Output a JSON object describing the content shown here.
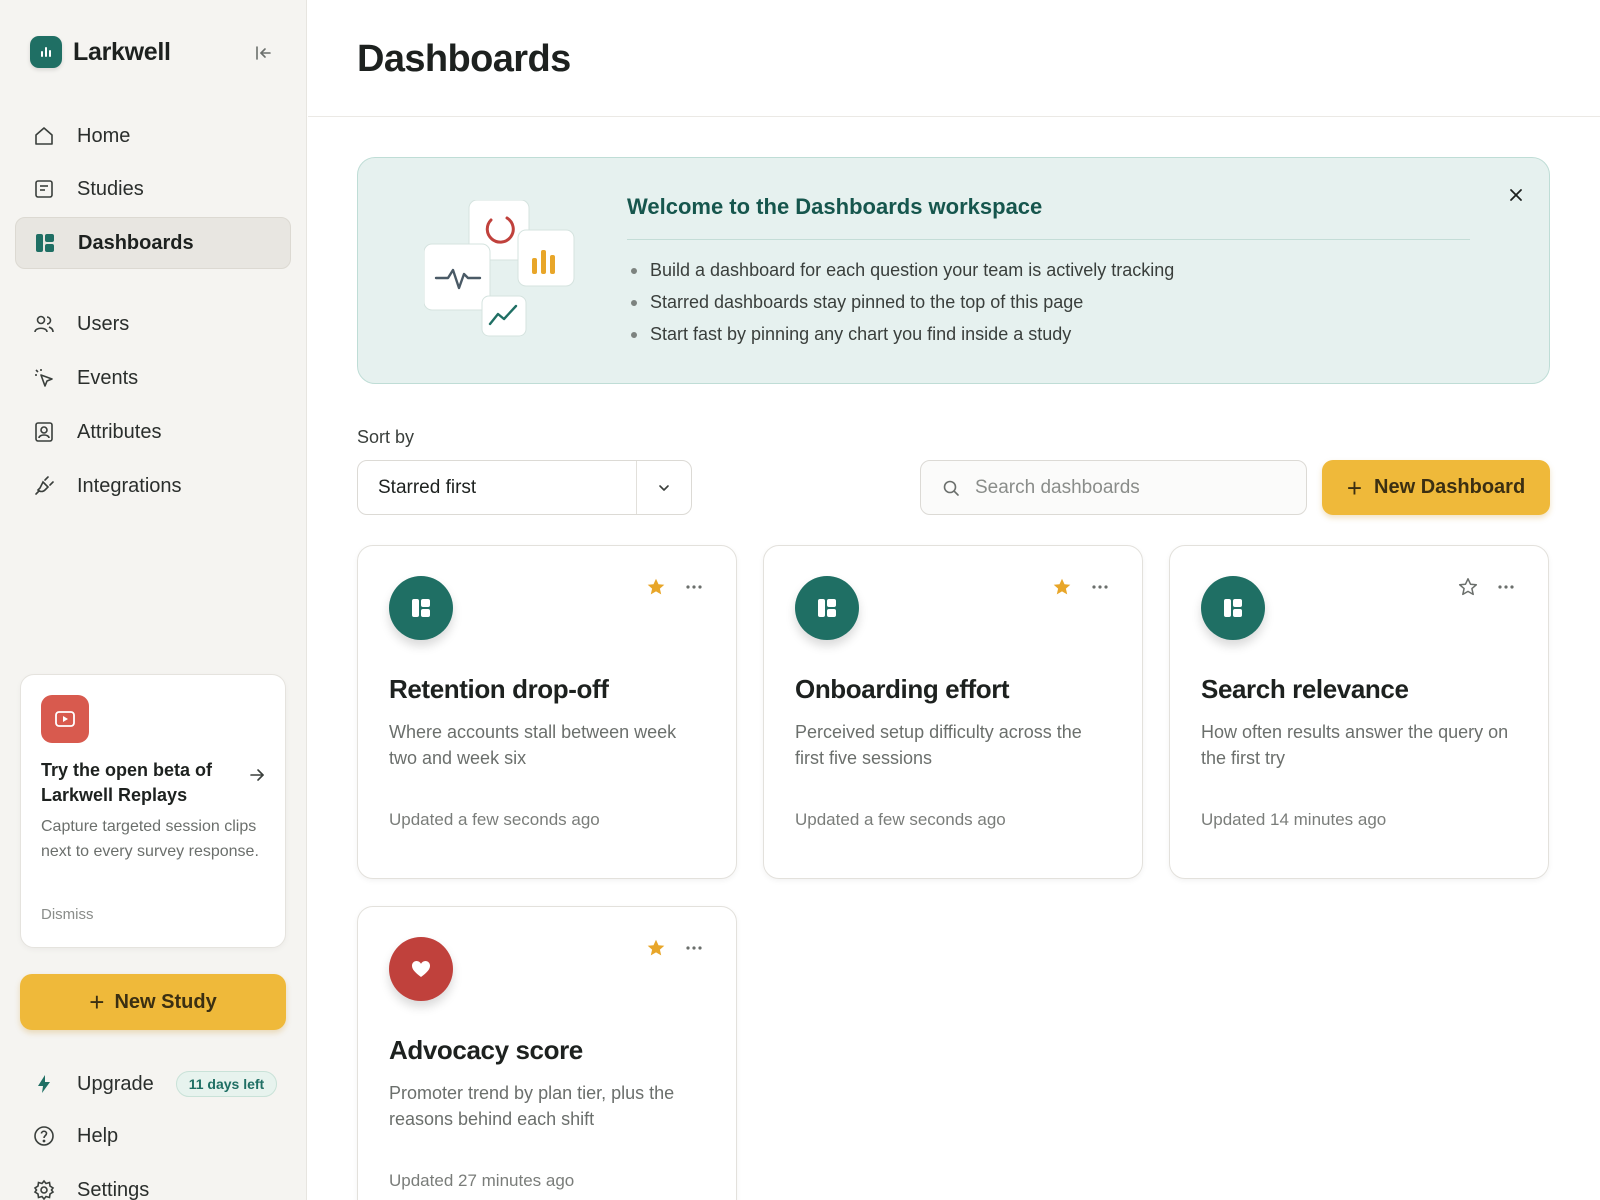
{
  "app": {
    "name": "Larkwell"
  },
  "sidebar": {
    "nav": [
      {
        "label": "Home",
        "icon": "home-icon"
      },
      {
        "label": "Studies",
        "icon": "document-icon"
      },
      {
        "label": "Dashboards",
        "icon": "dashboard-icon",
        "active": true
      },
      {
        "label": "Users",
        "icon": "users-icon"
      },
      {
        "label": "Events",
        "icon": "cursor-click-icon"
      },
      {
        "label": "Attributes",
        "icon": "id-card-icon"
      },
      {
        "label": "Integrations",
        "icon": "plug-icon"
      }
    ],
    "promo": {
      "title": "Try the open beta of Larkwell Replays",
      "text": "Capture targeted session clips next to every survey response.",
      "dismiss": "Dismiss"
    },
    "new_study": "New Study",
    "upgrade": {
      "label": "Upgrade",
      "badge": "11 days left"
    },
    "help": "Help",
    "settings": "Settings"
  },
  "main": {
    "title": "Dashboards",
    "banner": {
      "title": "Welcome to the Dashboards workspace",
      "points": [
        "Build a dashboard for each question your team is actively tracking",
        "Starred dashboards stay pinned to the top of this page",
        "Start fast by pinning any chart you find inside a study"
      ]
    },
    "sort": {
      "label": "Sort by",
      "value": "Starred first"
    },
    "search": {
      "placeholder": "Search dashboards"
    },
    "new_dashboard": "New Dashboard",
    "cards": [
      {
        "title": "Retention drop-off",
        "description": "Where accounts stall between week two and week six",
        "updated": "Updated a few seconds ago",
        "starred": true,
        "icon": "dashboard-icon",
        "color": "#1f6f64"
      },
      {
        "title": "Onboarding effort",
        "description": "Perceived setup difficulty across the first five sessions",
        "updated": "Updated a few seconds ago",
        "starred": true,
        "icon": "dashboard-icon",
        "color": "#1f6f64"
      },
      {
        "title": "Search relevance",
        "description": "How often results answer the query on the first try",
        "updated": "Updated 14 minutes ago",
        "starred": false,
        "icon": "dashboard-icon",
        "color": "#1f6f64"
      },
      {
        "title": "Advocacy score",
        "description": "Promoter trend by plan tier, plus the reasons behind each shift",
        "updated": "Updated 27 minutes ago",
        "starred": true,
        "icon": "heart-icon",
        "color": "#c0413c"
      }
    ]
  },
  "colors": {
    "accent": "#efb93a",
    "brand": "#1f6f64",
    "star": "#e8a629",
    "danger": "#c0413c"
  }
}
